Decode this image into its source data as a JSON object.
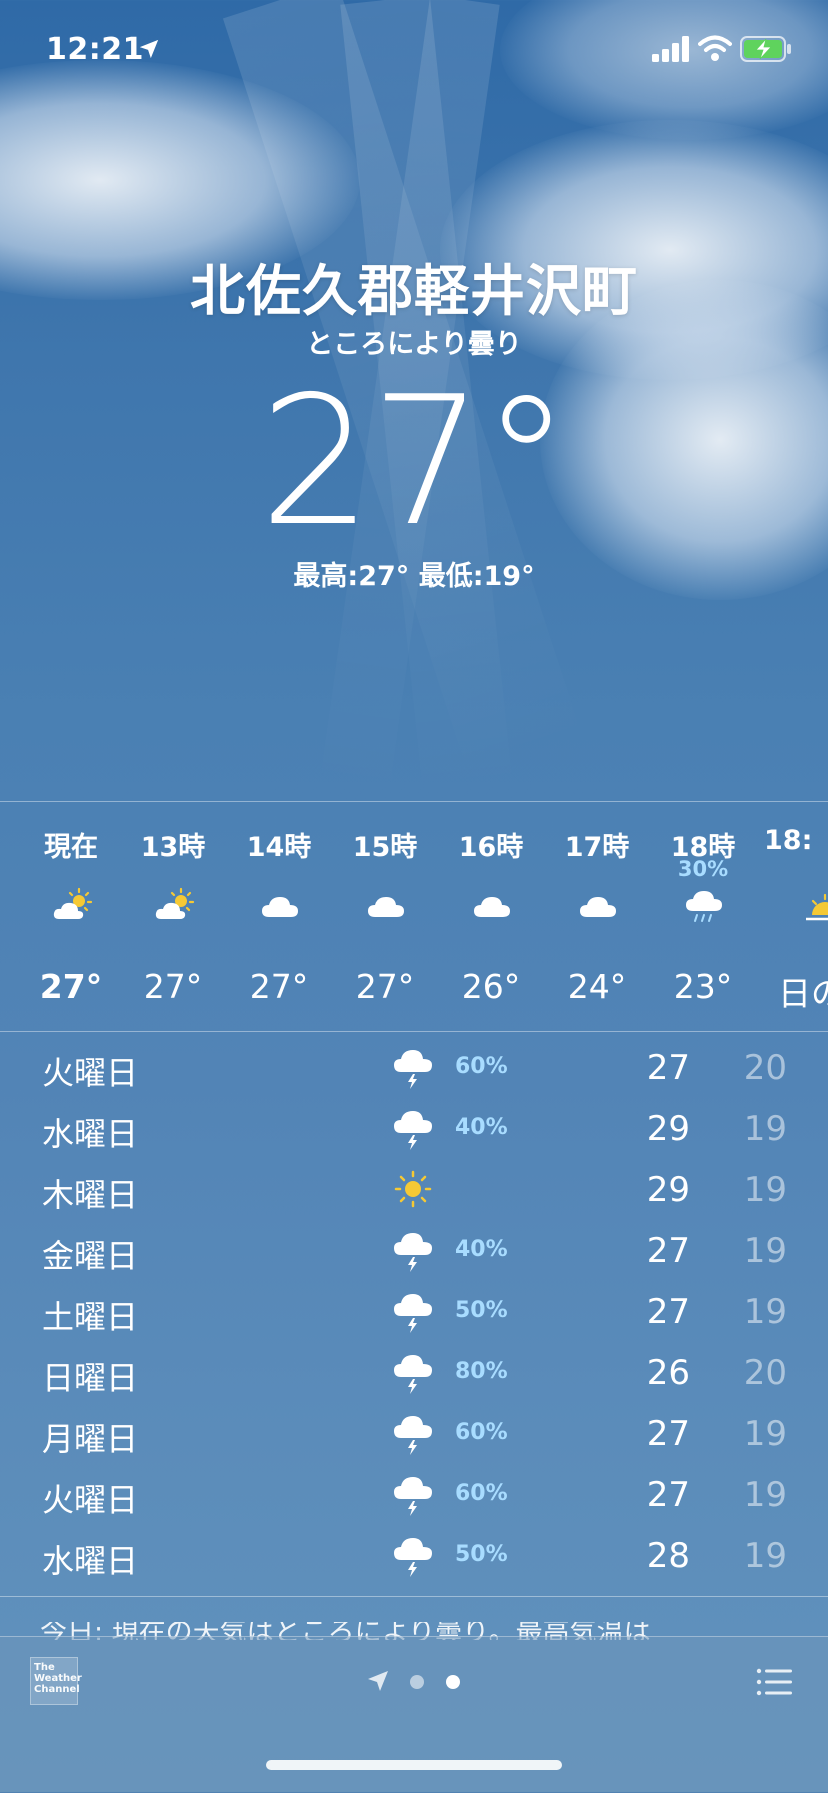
{
  "status_bar": {
    "time": "12:21",
    "icons": [
      "location-arrow-icon",
      "signal-icon",
      "wifi-icon",
      "battery-charging-icon"
    ]
  },
  "current": {
    "city": "北佐久郡軽井沢町",
    "condition": "ところにより曇り",
    "temperature": "27°",
    "hi_lo": "最高:27° 最低:19°"
  },
  "hourly": [
    {
      "label": "現在",
      "icon": "partly-sunny-icon",
      "pop": "",
      "temp": "27°"
    },
    {
      "label": "13時",
      "icon": "partly-sunny-icon",
      "pop": "",
      "temp": "27°"
    },
    {
      "label": "14時",
      "icon": "cloud-icon",
      "pop": "",
      "temp": "27°"
    },
    {
      "label": "15時",
      "icon": "cloud-icon",
      "pop": "",
      "temp": "27°"
    },
    {
      "label": "16時",
      "icon": "cloud-icon",
      "pop": "",
      "temp": "26°"
    },
    {
      "label": "17時",
      "icon": "cloud-icon",
      "pop": "",
      "temp": "24°"
    },
    {
      "label": "18時",
      "icon": "rain-cloud-icon",
      "pop": "30%",
      "temp": "23°"
    },
    {
      "label": "18:",
      "icon": "sunset-icon",
      "pop": "",
      "temp": "日の"
    }
  ],
  "daily": [
    {
      "day": "火曜日",
      "icon": "thunderstorm-icon",
      "pop": "60%",
      "high": "27",
      "low": "20"
    },
    {
      "day": "水曜日",
      "icon": "thunderstorm-icon",
      "pop": "40%",
      "high": "29",
      "low": "19"
    },
    {
      "day": "木曜日",
      "icon": "sun-icon",
      "pop": "",
      "high": "29",
      "low": "19"
    },
    {
      "day": "金曜日",
      "icon": "thunderstorm-icon",
      "pop": "40%",
      "high": "27",
      "low": "19"
    },
    {
      "day": "土曜日",
      "icon": "thunderstorm-icon",
      "pop": "50%",
      "high": "27",
      "low": "19"
    },
    {
      "day": "日曜日",
      "icon": "thunderstorm-icon",
      "pop": "80%",
      "high": "26",
      "low": "20"
    },
    {
      "day": "月曜日",
      "icon": "thunderstorm-icon",
      "pop": "60%",
      "high": "27",
      "low": "19"
    },
    {
      "day": "火曜日",
      "icon": "thunderstorm-icon",
      "pop": "60%",
      "high": "27",
      "low": "19"
    },
    {
      "day": "水曜日",
      "icon": "thunderstorm-icon",
      "pop": "50%",
      "high": "28",
      "low": "19"
    }
  ],
  "summary": "今日: 現在の天気はところにより曇り。最高気温は",
  "toolbar": {
    "provider_logo_text": "The Weather Channel",
    "page_dots": 2,
    "active_page": 2
  },
  "colors": {
    "pop_text": "#a8dcff",
    "sun": "#f5c935",
    "low_temp": "rgba(255,255,255,0.5)"
  }
}
